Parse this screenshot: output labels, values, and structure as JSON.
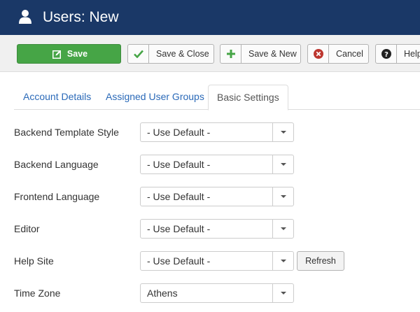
{
  "header": {
    "title": "Users: New",
    "icon": "user-icon"
  },
  "toolbar": {
    "save": "Save",
    "save_close": "Save & Close",
    "save_new": "Save & New",
    "cancel": "Cancel",
    "help": "Help"
  },
  "tabs": [
    "Account Details",
    "Assigned User Groups",
    "Basic Settings"
  ],
  "form": {
    "fields": [
      {
        "label": "Backend Template Style",
        "value": "- Use Default -"
      },
      {
        "label": "Backend Language",
        "value": "- Use Default -"
      },
      {
        "label": "Frontend Language",
        "value": "- Use Default -"
      },
      {
        "label": "Editor",
        "value": "- Use Default -"
      },
      {
        "label": "Help Site",
        "value": "- Use Default -"
      },
      {
        "label": "Time Zone",
        "value": "Athens"
      }
    ],
    "refresh": "Refresh"
  },
  "colors": {
    "header_bg": "#1a3867",
    "save_bg": "#46a546",
    "link": "#2a69b8"
  }
}
